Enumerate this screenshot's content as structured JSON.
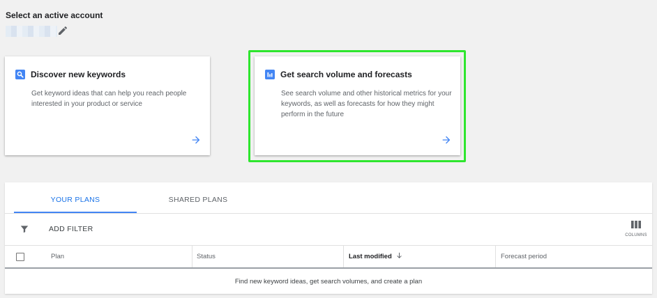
{
  "account": {
    "title": "Select an active account",
    "edit_icon": "pencil-icon"
  },
  "cards": [
    {
      "icon": "search-icon",
      "title": "Discover new keywords",
      "description": "Get keyword ideas that can help you reach people interested in your product or service",
      "arrow_icon": "arrow-right-icon"
    },
    {
      "icon": "bar-chart-icon",
      "title": "Get search volume and forecasts",
      "description": "See search volume and other historical metrics for your keywords, as well as forecasts for how they might perform in the future",
      "arrow_icon": "arrow-right-icon"
    }
  ],
  "tabs": [
    {
      "label": "YOUR PLANS",
      "active": true
    },
    {
      "label": "SHARED PLANS",
      "active": false
    }
  ],
  "toolbar": {
    "filter_icon": "filter-icon",
    "add_filter_label": "ADD FILTER",
    "columns_label": "COLUMNS",
    "columns_icon": "columns-icon"
  },
  "table": {
    "columns": [
      "Plan",
      "Status",
      "Last modified",
      "Forecast period"
    ],
    "sorted_column": "Last modified",
    "sort_direction": "descending",
    "empty_message": "Find new keyword ideas, get search volumes, and create a plan"
  },
  "colors": {
    "accent": "#1a73e8",
    "icon_blue": "#4285f4",
    "highlight": "#2ee62e",
    "background": "#f1f1f1"
  }
}
